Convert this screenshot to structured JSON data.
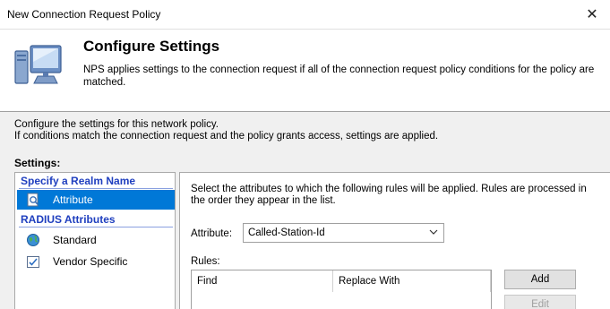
{
  "window": {
    "title": "New Connection Request Policy",
    "close_glyph": "✕"
  },
  "header": {
    "title": "Configure Settings",
    "description": "NPS applies settings to the connection request if all of the connection request policy conditions  for the policy are matched.",
    "icon": "monitor-icon"
  },
  "intro": {
    "line1": "Configure the settings for this network policy.",
    "line2": "If conditions match the connection request and the policy grants access, settings are applied."
  },
  "settings_label": "Settings:",
  "sidebar": {
    "groups": [
      {
        "header": "Specify a Realm Name",
        "items": [
          {
            "label": "Attribute",
            "icon": "attribute-icon",
            "selected": true
          }
        ]
      },
      {
        "header": "RADIUS Attributes",
        "items": [
          {
            "label": "Standard",
            "icon": "globe-icon",
            "selected": false
          },
          {
            "label": "Vendor Specific",
            "icon": "checklist-icon",
            "selected": false
          }
        ]
      }
    ]
  },
  "main": {
    "description": "Select the attributes to which the following rules will be applied. Rules are processed in the order they appear in the list.",
    "attribute_label": "Attribute:",
    "attribute_value": "Called-Station-Id",
    "rules_label": "Rules:",
    "columns": [
      "Find",
      "Replace With"
    ],
    "buttons": {
      "add": "Add",
      "edit": "Edit"
    }
  },
  "colors": {
    "selection": "#0078d7",
    "group_header": "#1f3fbf",
    "body_bg": "#f0f0f0"
  }
}
